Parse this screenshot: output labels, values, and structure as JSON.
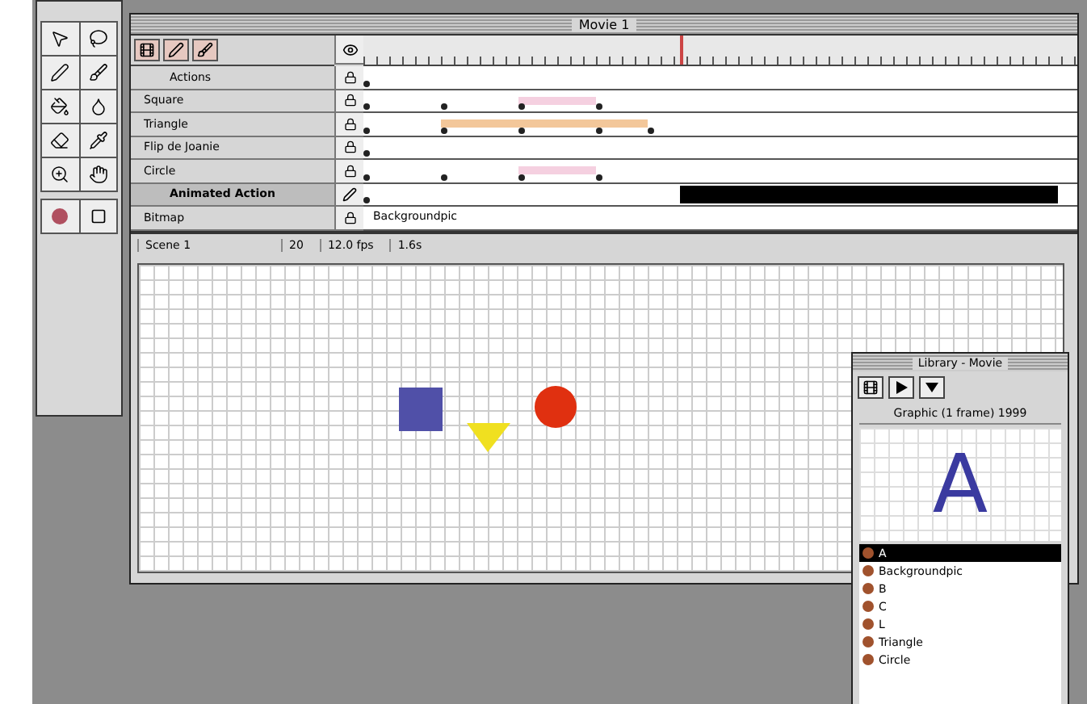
{
  "window": {
    "title": "Movie 1"
  },
  "layers": [
    {
      "name": "Actions",
      "kind": "static",
      "selected": false
    },
    {
      "name": "Square",
      "kind": "motion",
      "selected": false
    },
    {
      "name": "Triangle",
      "kind": "shape",
      "selected": false
    },
    {
      "name": "Flip de Joanie",
      "kind": "static",
      "selected": false
    },
    {
      "name": "Circle",
      "kind": "motion",
      "selected": false
    },
    {
      "name": "Animated Action",
      "kind": "static",
      "selected": true
    },
    {
      "name": "Bitmap",
      "kind": "label",
      "selected": false,
      "label": "Backgroundpic"
    }
  ],
  "status_bar": {
    "scene": "Scene 1",
    "frame": "20",
    "rate": "12.0 fps",
    "time": "1.6s"
  },
  "library": {
    "title": "Library - Movie",
    "info": "Graphic (1 frame) 1999",
    "preview": "A",
    "items": [
      {
        "name": "A",
        "selected": true
      },
      {
        "name": "Backgroundpic",
        "selected": false
      },
      {
        "name": "B",
        "selected": false
      },
      {
        "name": "C",
        "selected": false
      },
      {
        "name": "L",
        "selected": false
      },
      {
        "name": "Triangle",
        "selected": false
      },
      {
        "name": "Circle",
        "selected": false
      }
    ]
  }
}
